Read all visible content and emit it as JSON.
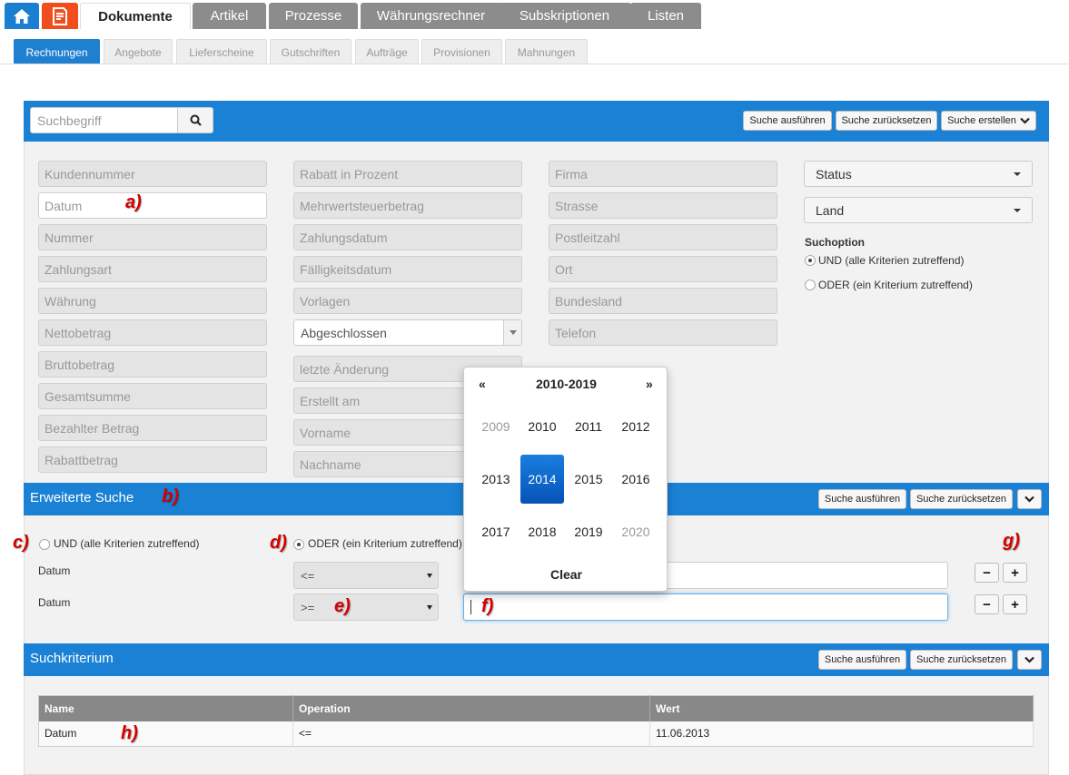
{
  "main_tabs": [
    "Dokumente",
    "Artikel",
    "Prozesse",
    "Währungsrechner",
    "Subskriptionen",
    "Listen"
  ],
  "sub_tabs": [
    "Rechnungen",
    "Angebote",
    "Lieferscheine",
    "Gutschriften",
    "Aufträge",
    "Provisionen",
    "Mahnungen"
  ],
  "search": {
    "placeholder": "Suchbegriff",
    "execute_label": "Suche ausführen",
    "reset_label": "Suche zurücksetzen",
    "create_label": "Suche erstellen"
  },
  "fields": {
    "col1": [
      "Kundennummer",
      "Datum",
      "Nummer",
      "Zahlungsart",
      "Währung",
      "Nettobetrag",
      "Bruttobetrag",
      "Gesamtsumme",
      "Bezahlter Betrag",
      "Rabattbetrag"
    ],
    "col2": [
      "Rabatt in Prozent",
      "Mehrwertsteuerbetrag",
      "Zahlungsdatum",
      "Fälligkeitsdatum",
      "Vorlagen",
      "Abgeschlossen",
      "letzte Änderung",
      "Erstellt am",
      "Vorname",
      "Nachname"
    ],
    "col3": [
      "Firma",
      "Strasse",
      "Postleitzahl",
      "Ort",
      "Bundesland",
      "Telefon"
    ]
  },
  "right_panel": {
    "status_label": "Status",
    "land_label": "Land",
    "suchoption_title": "Suchoption",
    "und_label": "UND (alle Kriterien zutreffend)",
    "oder_label": "ODER (ein Kriterium zutreffend)"
  },
  "advanced": {
    "title": "Erweiterte Suche",
    "execute_label": "Suche ausführen",
    "reset_label": "Suche zurücksetzen",
    "und_label": "UND (alle Kriterien zutreffend)",
    "oder_label": "ODER (ein Kriterium zutreffend)",
    "rows": [
      {
        "field": "Datum",
        "op": "<="
      },
      {
        "field": "Datum",
        "op": ">="
      }
    ],
    "minus": "−",
    "plus": "+"
  },
  "criteria": {
    "title": "Suchkriterium",
    "execute_label": "Suche ausführen",
    "reset_label": "Suche zurücksetzen",
    "headers": [
      "Name",
      "Operation",
      "Wert"
    ],
    "rows": [
      {
        "name": "Datum",
        "op": "<=",
        "value": "11.06.2013"
      }
    ]
  },
  "datepicker": {
    "prev": "«",
    "next": "»",
    "title": "2010-2019",
    "years": [
      "2009",
      "2010",
      "2011",
      "2012",
      "2013",
      "2014",
      "2015",
      "2016",
      "2017",
      "2018",
      "2019",
      "2020"
    ],
    "selected": "2014",
    "clear_label": "Clear"
  },
  "annotations": [
    "a)",
    "b)",
    "c)",
    "d)",
    "e)",
    "f)",
    "g)",
    "h)"
  ],
  "colors": {
    "accent_blue": "#1a81d4",
    "home_blue": "#1a7fd0",
    "doc_orange": "#f04e1c",
    "annotation_red": "#d40000"
  }
}
